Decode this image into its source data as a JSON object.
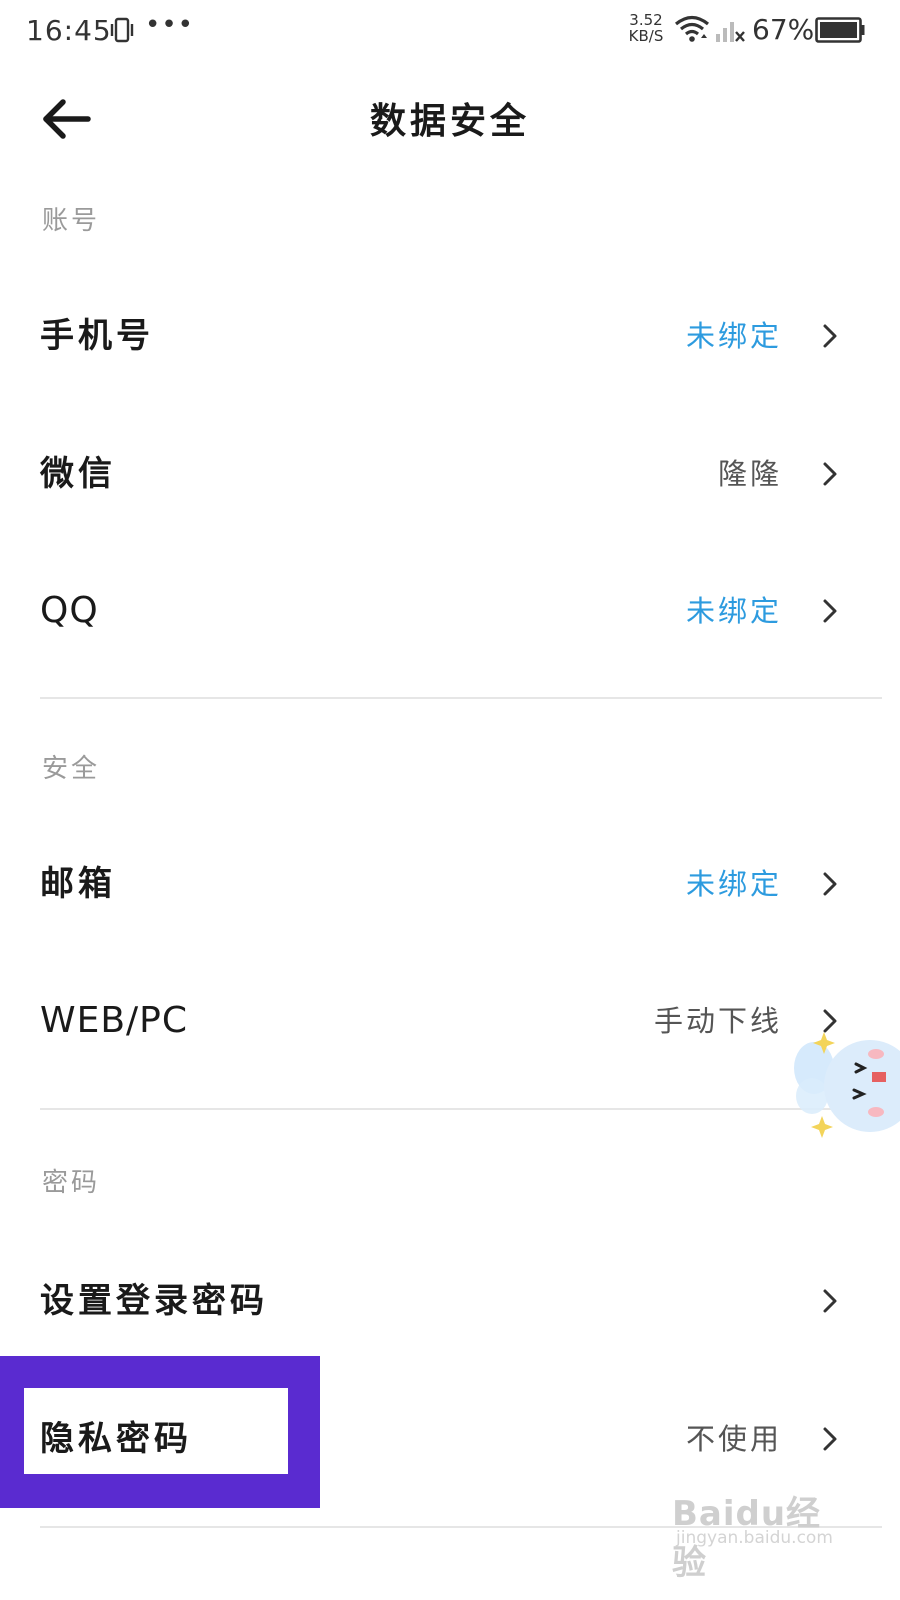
{
  "status_bar": {
    "time": "16:45",
    "more_dots": "•••",
    "net_speed_value": "3.52",
    "net_speed_unit": "KB/S",
    "battery_percent": "67%"
  },
  "header": {
    "title": "数据安全",
    "back_icon": "arrow-left-icon"
  },
  "sections": {
    "account": {
      "header": "账号",
      "rows": [
        {
          "label": "手机号",
          "value": "未绑定"
        },
        {
          "label": "微信",
          "value": "隆隆"
        },
        {
          "label": "QQ",
          "value": "未绑定"
        }
      ]
    },
    "security": {
      "header": "安全",
      "rows": [
        {
          "label": "邮箱",
          "value": "未绑定"
        },
        {
          "label": "WEB/PC",
          "value": "手动下线"
        }
      ]
    },
    "password": {
      "header": "密码",
      "rows": [
        {
          "label": "设置登录密码",
          "value": ""
        },
        {
          "label": "隐私密码",
          "value": "不使用"
        }
      ]
    }
  },
  "watermark": {
    "brand": "Baidu经验",
    "url": "jingyan.baidu.com"
  },
  "colors": {
    "accent": "#2d9bdf",
    "highlight": "#5a2bd0",
    "muted": "#9a9a9a",
    "divider": "#e6e6e6"
  }
}
